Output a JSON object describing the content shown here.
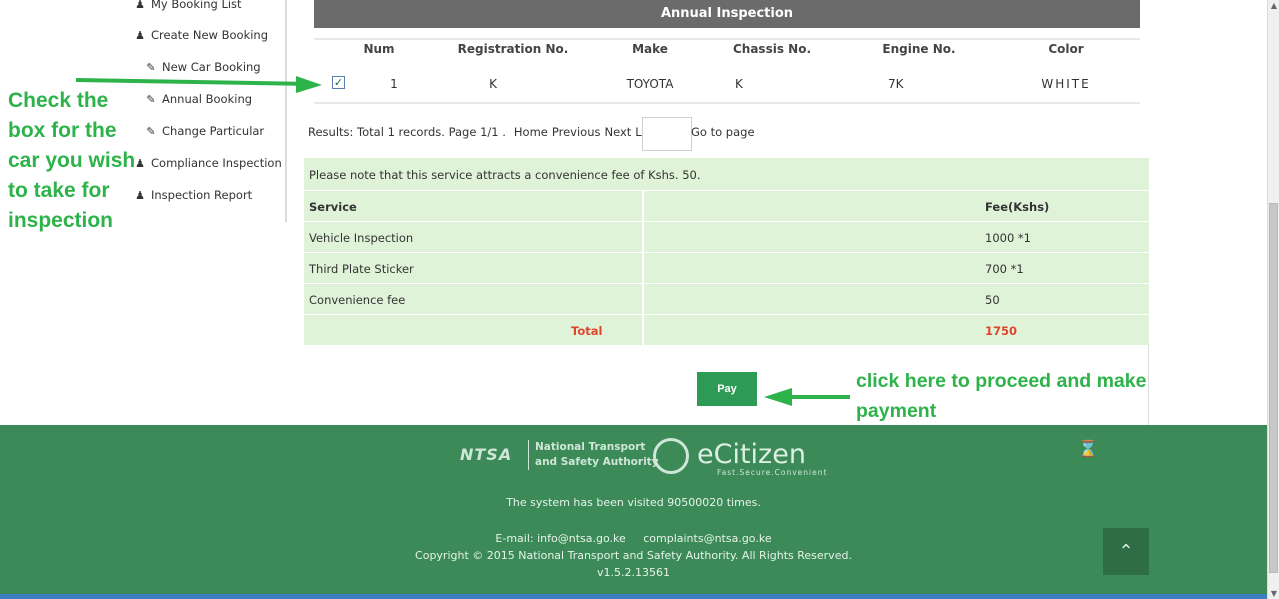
{
  "sidebar": {
    "items": [
      {
        "label": "My Booking List",
        "icon": "user-icon"
      },
      {
        "label": "Create New Booking",
        "icon": "user-icon"
      },
      {
        "label": "New Car Booking",
        "icon": "pencil-icon"
      },
      {
        "label": "Annual Booking",
        "icon": "pencil-icon"
      },
      {
        "label": "Change Particular",
        "icon": "pencil-icon"
      },
      {
        "label": "Compliance Inspection",
        "icon": "user-icon"
      },
      {
        "label": "Inspection Report",
        "icon": "user-icon"
      }
    ]
  },
  "annotations": {
    "left": "Check the box for the car you wish to take for inspection",
    "right": "click here to proceed and make payment",
    "color": "#2db34a"
  },
  "grid": {
    "title": "Annual Inspection",
    "columns": [
      "Num",
      "Registration No.",
      "Make",
      "Chassis No.",
      "Engine No.",
      "Color"
    ],
    "rows": [
      {
        "checked": true,
        "num": "1",
        "registration": "K",
        "make": "TOYOTA",
        "chassis": "K",
        "engine": "7K",
        "color": "WHITE"
      }
    ]
  },
  "pager": {
    "results": "Results: Total 1 records. Page 1/1 .",
    "home": "Home",
    "previous": "Previous",
    "next": "Next",
    "last": "Last",
    "goto_label": "Go to page",
    "goto_value": ""
  },
  "fees": {
    "note": "Please note that this service attracts a convenience fee of Kshs. 50.",
    "header": {
      "service": "Service",
      "fee": "Fee(Kshs)"
    },
    "rows": [
      {
        "service": "Vehicle Inspection",
        "fee": "1000 *1"
      },
      {
        "service": "Third Plate Sticker",
        "fee": "700 *1"
      },
      {
        "service": "Convenience fee",
        "fee": "50"
      }
    ],
    "total": {
      "label": "Total",
      "value": "1750"
    }
  },
  "pay_button": "Pay",
  "footer": {
    "ntsa_logo": "NTSA",
    "ntsa_line1": "National Transport",
    "ntsa_line2": "and Safety Authority",
    "ecitizen_name": "eCitizen",
    "ecitizen_tag": "Fast.Secure.Convenient",
    "visits": "The system has been visited 90500020 times.",
    "email": "E-mail: info@ntsa.go.ke     complaints@ntsa.go.ke",
    "copyright": "Copyright © 2015 National Transport and Safety Authority. All Rights Reserved.",
    "version": "v1.5.2.13561"
  },
  "colors": {
    "footer_green": "#3b8a57",
    "fee_panel": "#dff3d9",
    "pay_button": "#2d9a55",
    "total_red": "#e0452c",
    "grid_title_bar": "#6b6b6b"
  }
}
